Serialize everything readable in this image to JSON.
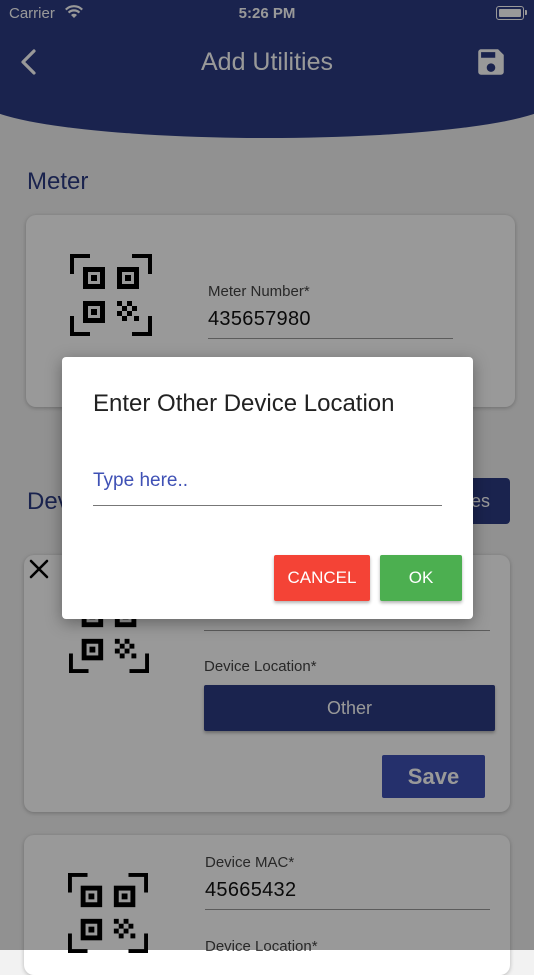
{
  "status_bar": {
    "carrier": "Carrier",
    "time": "5:26 PM",
    "icons": [
      "wifi-icon",
      "battery-icon"
    ]
  },
  "header": {
    "title": "Add Utilities",
    "back_icon": "chevron-left-icon",
    "save_icon": "floppy-disk-icon"
  },
  "meter_section": {
    "title": "Meter",
    "qr_icon": "qr-code-icon",
    "meter_number_label": "Meter Number*",
    "meter_number_value": "435657980"
  },
  "devices_section": {
    "title_fragment": "Dev",
    "button_fragment": "es"
  },
  "device_cards": [
    {
      "remove_icon": "close-icon",
      "qr_icon": "qr-code-icon",
      "location_label": "Device Location*",
      "location_value": "Other",
      "save_label": "Save"
    },
    {
      "qr_icon": "qr-code-icon",
      "mac_label": "Device MAC*",
      "mac_value": "45665432",
      "location_label": "Device Location*"
    }
  ],
  "dialog": {
    "title": "Enter Other Device Location",
    "input_value": "",
    "input_placeholder": "Type here..",
    "cancel_label": "CANCEL",
    "ok_label": "OK"
  },
  "colors": {
    "primary": "#2c3b82",
    "accent": "#3f51b5",
    "cancel": "#f44336",
    "ok": "#4caf50",
    "background": "#f2f2f2"
  }
}
